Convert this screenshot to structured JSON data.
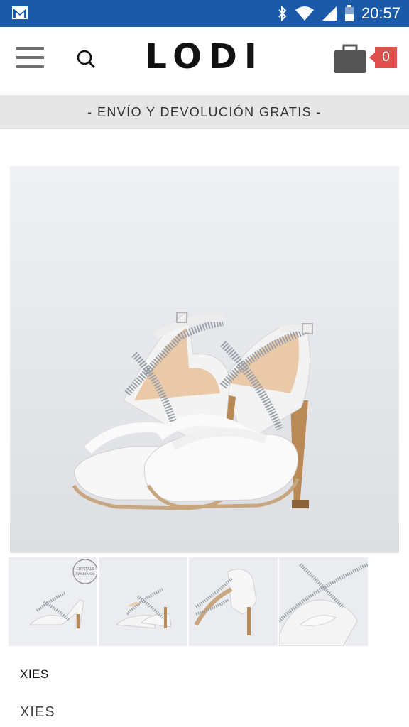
{
  "status_bar": {
    "time": "20:57",
    "icons": [
      "gmail-icon",
      "bluetooth-icon",
      "wifi-icon",
      "signal-icon",
      "battery-icon"
    ]
  },
  "header": {
    "logo": "LODI",
    "menu_icon": "hamburger-menu-icon",
    "search_icon": "search-icon",
    "cart_icon": "briefcase-cart-icon",
    "cart_count": "0"
  },
  "promo": {
    "text": "- ENVÍO Y DEVOLUCIÓN GRATIS -"
  },
  "gallery": {
    "main_image": "white-strappy-platform-sandals-with-silver-glitter-straps",
    "thumbnails": [
      {
        "image": "sandal-side-view",
        "badge": "CRYSTALS FROM SWAROVSKI"
      },
      {
        "image": "sandal-pair-front-view"
      },
      {
        "image": "sandal-back-view"
      },
      {
        "image": "sandal-toe-detail"
      }
    ]
  },
  "product": {
    "line": "XIES",
    "name": "XIES"
  },
  "colors": {
    "status_bar": "#1a5aa8",
    "cart_badge": "#e0504c",
    "promo_bg": "#e6e6e6"
  }
}
